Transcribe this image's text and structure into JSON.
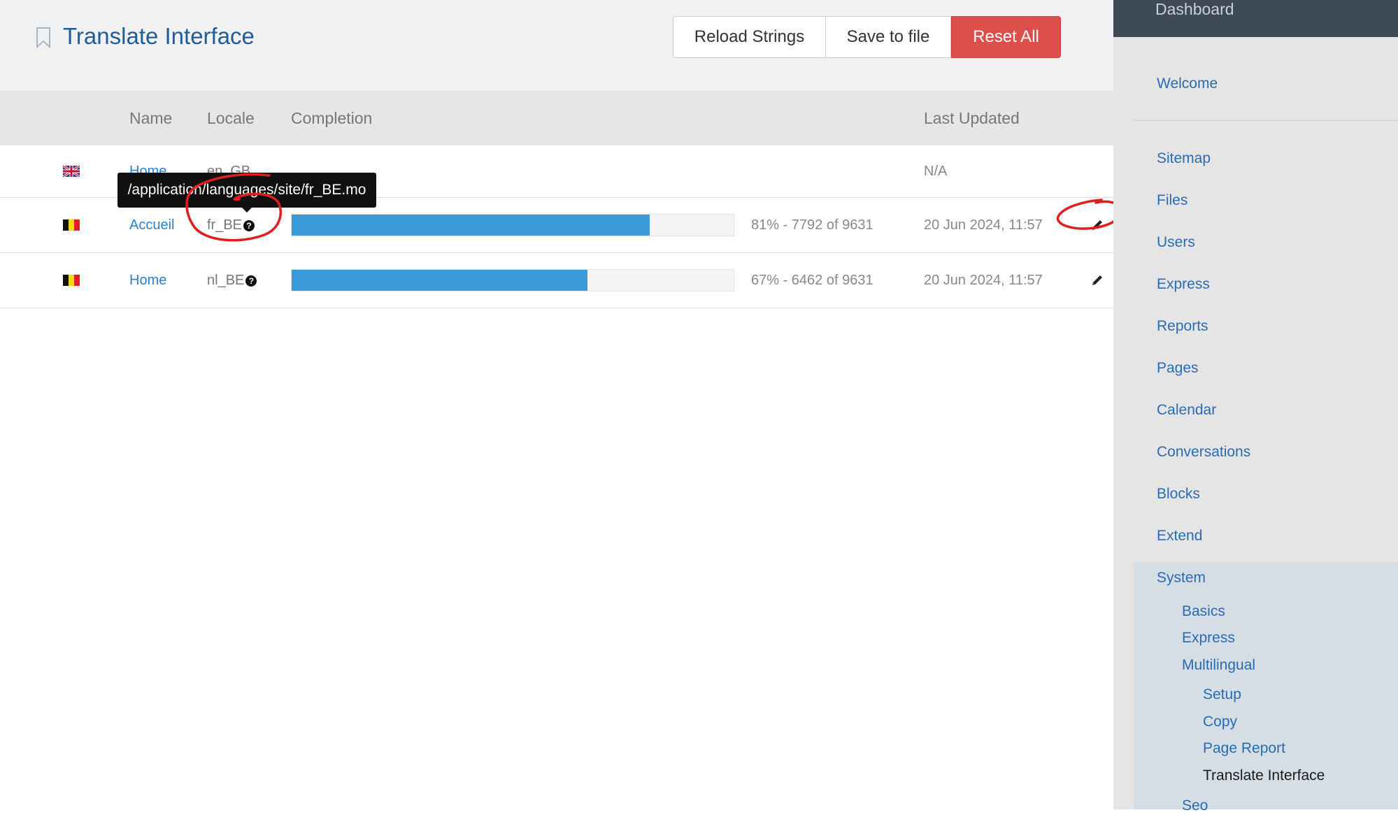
{
  "header": {
    "title": "Translate Interface",
    "buttons": {
      "reload": "Reload Strings",
      "save": "Save to file",
      "reset": "Reset All"
    }
  },
  "table": {
    "columns": [
      "Name",
      "Locale",
      "Completion",
      "Last Updated"
    ],
    "rows": [
      {
        "flag": "uk-flag",
        "name": "Home",
        "locale": "en_GB",
        "completion_percent": null,
        "completion_text": "",
        "last_updated": "N/A",
        "editable": false
      },
      {
        "flag": "belgium-flag",
        "name": "Accueil",
        "locale": "fr_BE",
        "completion_percent": 81,
        "completion_text": "81% - 7792 of 9631",
        "last_updated": "20 Jun 2024, 11:57",
        "editable": true
      },
      {
        "flag": "belgium-flag",
        "name": "Home",
        "locale": "nl_BE",
        "completion_percent": 67,
        "completion_text": "67% - 6462 of 9631",
        "last_updated": "20 Jun 2024, 11:57",
        "editable": true
      }
    ]
  },
  "tooltip": {
    "text": "/application/languages/site/fr_BE.mo"
  },
  "sidebar": {
    "top_label": "Dashboard",
    "items": [
      {
        "label": "Welcome"
      },
      {
        "label": "Sitemap"
      },
      {
        "label": "Files"
      },
      {
        "label": "Users"
      },
      {
        "label": "Express"
      },
      {
        "label": "Reports"
      },
      {
        "label": "Pages"
      },
      {
        "label": "Calendar"
      },
      {
        "label": "Conversations"
      },
      {
        "label": "Blocks"
      },
      {
        "label": "Extend"
      },
      {
        "label": "System"
      }
    ],
    "system_children": [
      {
        "label": "Basics"
      },
      {
        "label": "Express"
      },
      {
        "label": "Multilingual"
      }
    ],
    "multilingual_children": [
      {
        "label": "Setup"
      },
      {
        "label": "Copy"
      },
      {
        "label": "Page Report"
      },
      {
        "label": "Translate Interface",
        "active": true
      }
    ],
    "trailing_item": "Seo"
  },
  "colors": {
    "title": "#1f5c99",
    "link": "#2a7fd4",
    "progress": "#3a9ad9",
    "danger": "#dd4f4b",
    "annotation": "#e01e1e"
  },
  "icons": [
    "bookmark-icon",
    "uk-flag",
    "belgium-flag",
    "question-circle-icon",
    "pencil-icon"
  ]
}
